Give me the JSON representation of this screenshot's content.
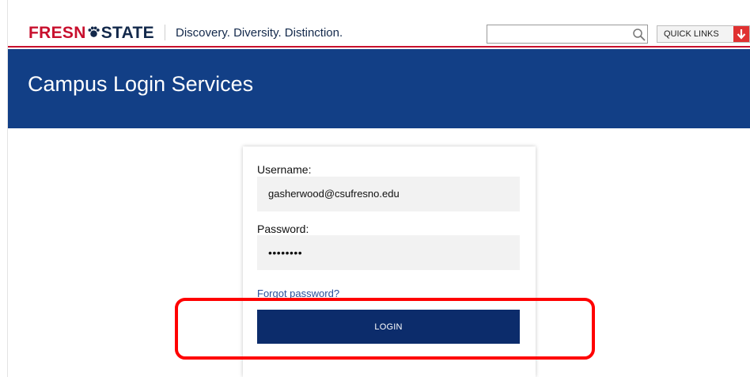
{
  "header": {
    "logo_left": "FRESN",
    "logo_right": "STATE",
    "tagline": "Discovery. Diversity. Distinction.",
    "search": {
      "value": "",
      "placeholder": "",
      "icon": "search-icon"
    },
    "quick_links_label": "QUICK LINKS",
    "quick_links_icon": "arrow-down-icon"
  },
  "banner": {
    "title": "Campus Login Services"
  },
  "login_form": {
    "username_label": "Username:",
    "username_value": "gasherwood@csufresno.edu",
    "password_label": "Password:",
    "password_value": "••••••••",
    "forgot_link": "Forgot password?",
    "login_button": "LOGIN"
  },
  "colors": {
    "brand_red": "#c8102e",
    "brand_navy": "#13294b",
    "banner_blue": "#123f86",
    "button_navy": "#0c2c6b",
    "highlight_red": "#ff0000"
  }
}
